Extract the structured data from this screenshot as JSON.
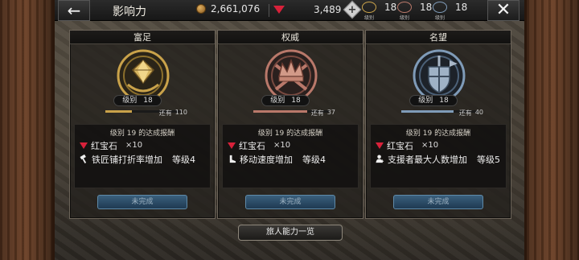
{
  "topbar": {
    "back_label": "←",
    "title": "影响力",
    "gold_amount": "2,661,076",
    "ruby_amount": "3,489",
    "add_label": "+",
    "levels": [
      {
        "value": "18",
        "caption": "级别"
      },
      {
        "value": "18",
        "caption": "级别"
      },
      {
        "value": "18",
        "caption": "级别"
      }
    ],
    "close_label": "✕"
  },
  "panels": [
    {
      "header": "富足",
      "emblem_icon": "diamond-crest-icon",
      "level_label": "级别",
      "level_value": "18",
      "remaining_label": "还有",
      "remaining_value": "110",
      "progress": 0.35,
      "reward_title": "级别  19  的达成报酬",
      "reward_item": "红宝石",
      "reward_qty": "×10",
      "skill_name": "铁匠铺打折率增加",
      "skill_level": "等级4",
      "skill_icon": "hammer-icon",
      "status": "未完成"
    },
    {
      "header": "权威",
      "emblem_icon": "crown-crest-icon",
      "level_label": "级别",
      "level_value": "18",
      "remaining_label": "还有",
      "remaining_value": "37",
      "progress": 0.7,
      "reward_title": "级别  19  的达成报酬",
      "reward_item": "红宝石",
      "reward_qty": "×10",
      "skill_name": "移动速度增加",
      "skill_level": "等级4",
      "skill_icon": "boot-icon",
      "status": "未完成"
    },
    {
      "header": "名望",
      "emblem_icon": "shield-crest-icon",
      "level_label": "级别",
      "level_value": "18",
      "remaining_label": "还有",
      "remaining_value": "40",
      "progress": 0.68,
      "reward_title": "级别  19  的达成报酬",
      "reward_item": "红宝石",
      "reward_qty": "×10",
      "skill_name": "支援者最大人数增加",
      "skill_level": "等级5",
      "skill_icon": "person-icon",
      "status": "未完成"
    }
  ],
  "footer": {
    "traveler_list_label": "旅人能力一览"
  },
  "colors": {
    "wealth": "#c9a24a",
    "authority": "#b9786a",
    "fame": "#7f9bb8",
    "ruby": "#d8213a",
    "status_button": "#2c4c66"
  }
}
